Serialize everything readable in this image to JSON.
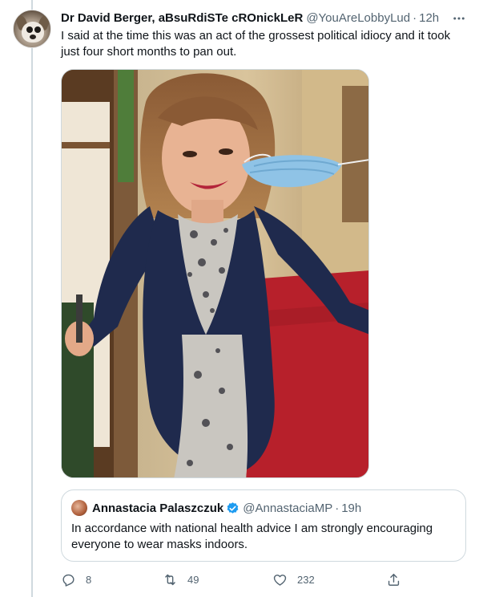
{
  "tweet": {
    "author_name": "Dr David Berger, aBsuRdiSTe cROnickLeR",
    "author_handle": "@YouAreLobbyLud",
    "separator": "·",
    "time": "12h",
    "text": "I said at the time this was an act of the grossest political idiocy and it took just four short months to pan out."
  },
  "media": {
    "icon": "video-thumbnail",
    "colors": {
      "coat": "#1f2a4d",
      "carpet": "#b7202b",
      "mask": "#8fc3e6",
      "wall": "#e2d2b0"
    }
  },
  "quoted_tweet": {
    "author_name": "Annastacia Palaszczuk",
    "author_handle": "@AnnastaciaMP",
    "separator": "·",
    "time": "19h",
    "verified": true,
    "text": "In accordance with national health advice I am strongly encouraging everyone to wear masks indoors."
  },
  "actions": {
    "replies": "8",
    "retweets": "49",
    "likes": "232"
  },
  "colors": {
    "text": "#0f1419",
    "secondary": "#536471",
    "border": "#cfd9de",
    "verified": "#1d9bf0"
  }
}
